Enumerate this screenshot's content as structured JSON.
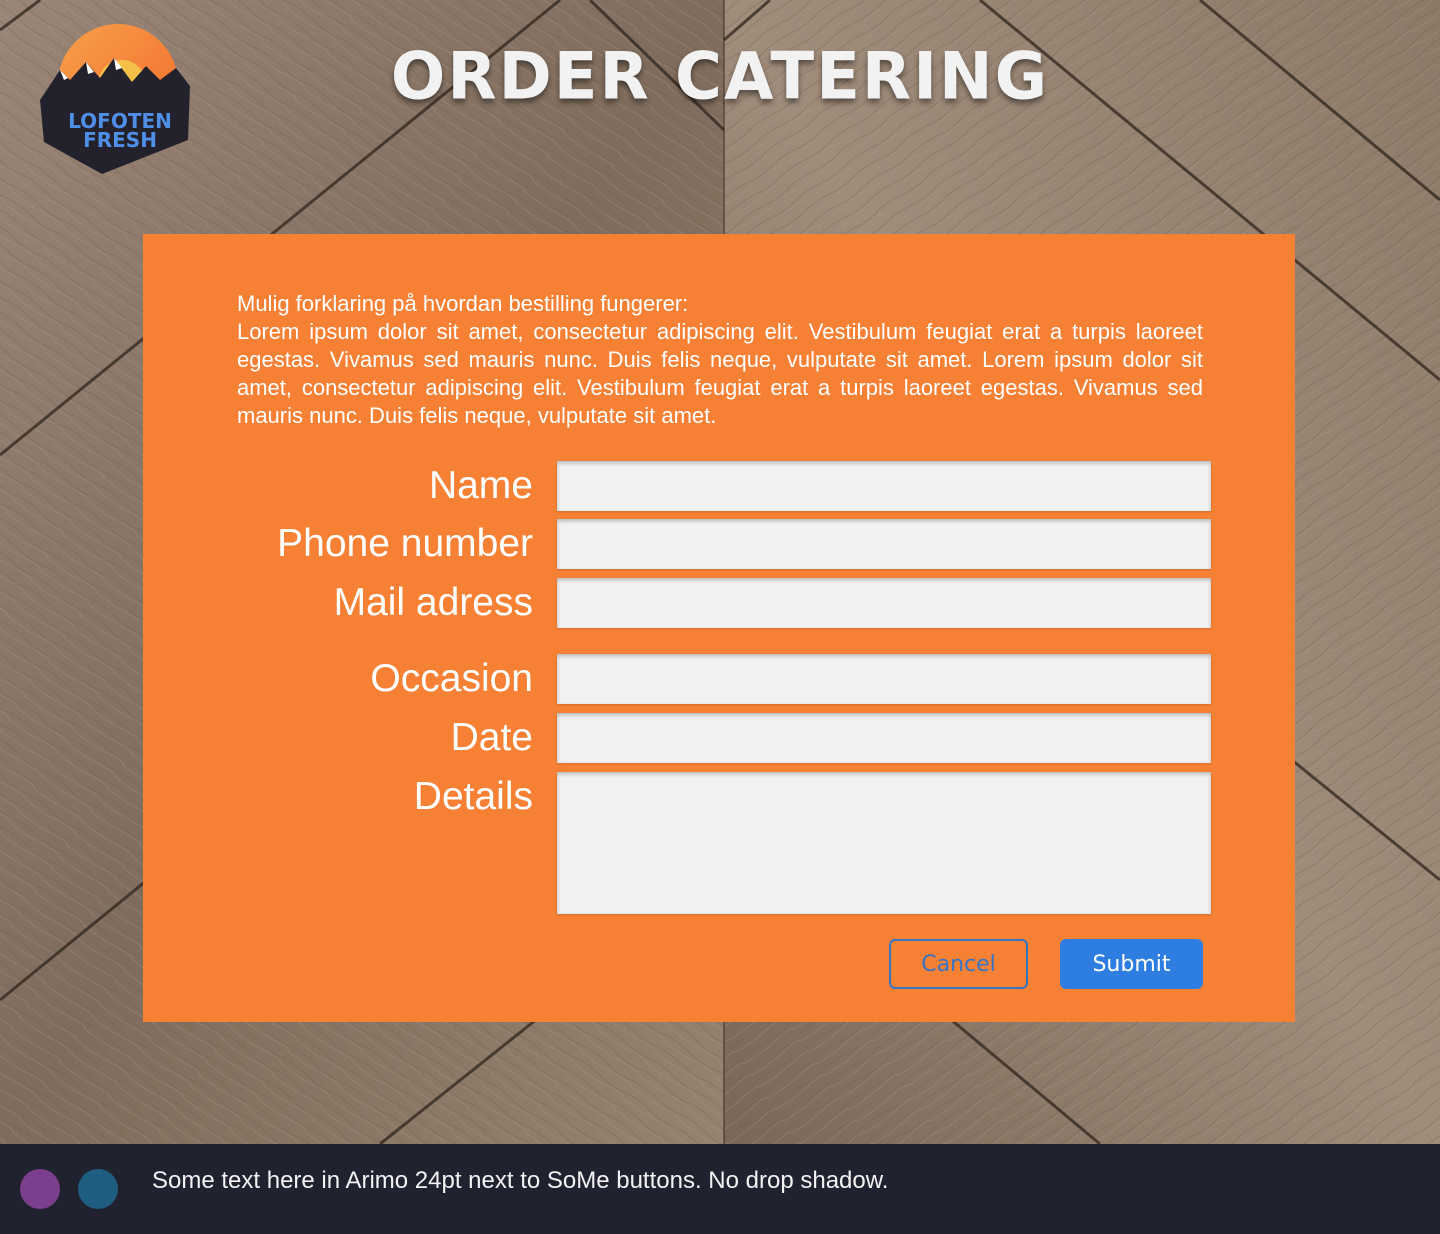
{
  "brand": {
    "logo_line1": "LOFOTEN",
    "logo_line2": "FRESH"
  },
  "header": {
    "title": "ORDER CATERING"
  },
  "form": {
    "intro_heading": "Mulig forklaring på hvordan bestilling fungerer:",
    "intro_body": "Lorem ipsum dolor sit amet, consectetur adipiscing elit. Vestibulum feugiat erat a turpis laoreet egestas. Vivamus sed mauris nunc. Duis felis neque, vulputate sit amet. Lorem ipsum dolor sit amet, consectetur adipiscing elit. Vestibulum feugiat erat a turpis laoreet egestas. Vivamus sed mauris nunc. Duis felis neque, vulputate sit amet.",
    "fields": [
      {
        "label": "Name",
        "value": ""
      },
      {
        "label": "Phone number",
        "value": ""
      },
      {
        "label": "Mail adress",
        "value": ""
      },
      {
        "label": "Occasion",
        "value": ""
      },
      {
        "label": "Date",
        "value": ""
      },
      {
        "label": "Details",
        "value": ""
      }
    ],
    "cancel_label": "Cancel",
    "submit_label": "Submit"
  },
  "footer": {
    "text": "Some text here in Arimo 24pt next to SoMe buttons. No drop shadow.",
    "social_colors": [
      "#7c3f8e",
      "#1f5e80"
    ]
  },
  "colors": {
    "panel": "#f68135",
    "primary_button": "#2d7ee0",
    "footer_bg": "#212230"
  }
}
